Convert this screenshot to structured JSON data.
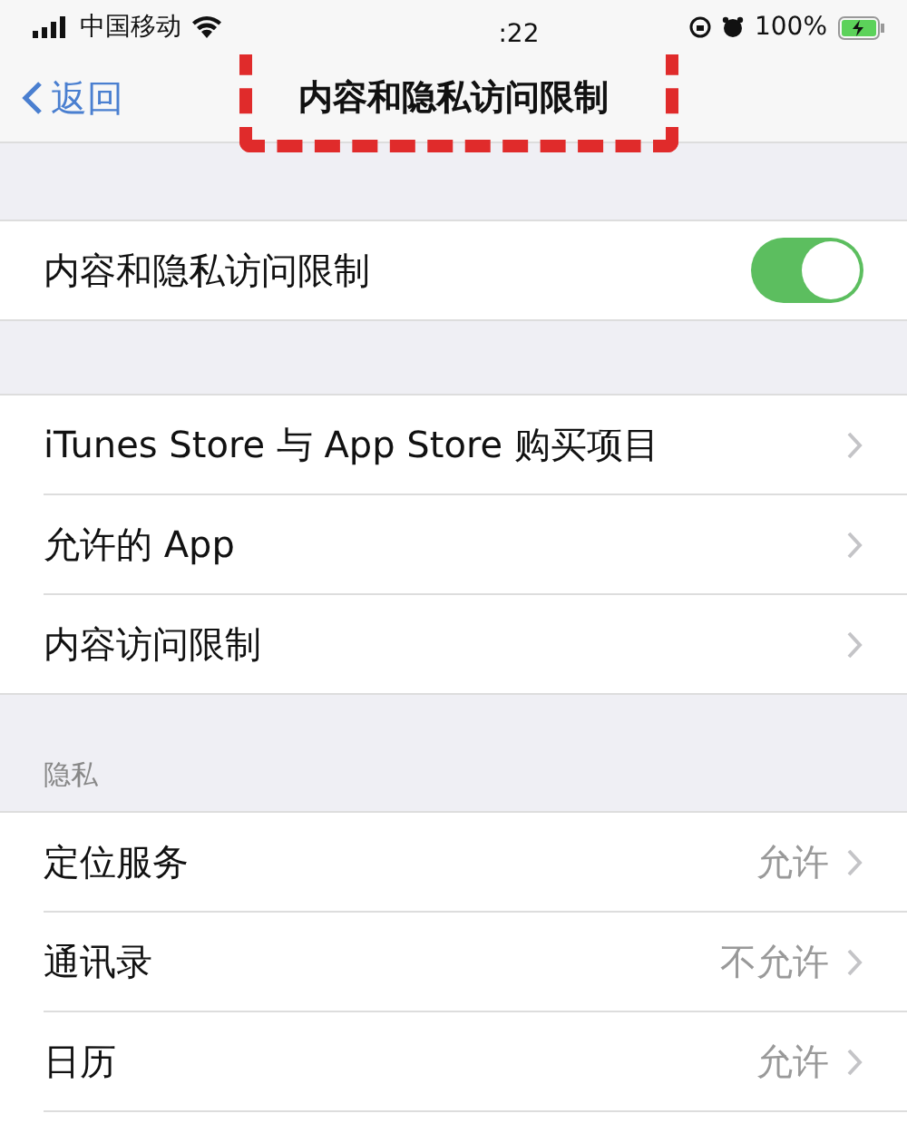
{
  "status_bar": {
    "carrier": "中国移动",
    "time": ":22",
    "battery": "100%"
  },
  "nav": {
    "back": "返回",
    "title": "内容和隐私访问限制"
  },
  "annotation": {
    "kind": "dashed-box"
  },
  "toggle_row": {
    "label": "内容和隐私访问限制",
    "on": true
  },
  "group1": [
    {
      "label": "iTunes Store 与 App Store 购买项目"
    },
    {
      "label": "允许的 App"
    },
    {
      "label": "内容访问限制"
    }
  ],
  "privacy": {
    "header": "隐私",
    "rows": [
      {
        "label": "定位服务",
        "value": "允许"
      },
      {
        "label": "通讯录",
        "value": "不允许"
      },
      {
        "label": "日历",
        "value": "允许"
      }
    ]
  }
}
